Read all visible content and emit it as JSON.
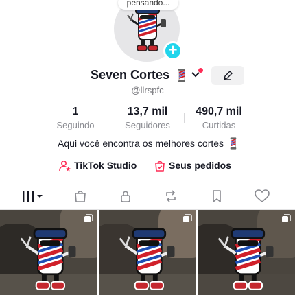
{
  "profile": {
    "status_bubble": "pensando...",
    "display_name": "Seven Cortes",
    "username": "@llrspfc",
    "bio": "Aqui você encontra os melhores cortes"
  },
  "stats": [
    {
      "value": "1",
      "label": "Seguindo"
    },
    {
      "value": "13,7 mil",
      "label": "Seguidores"
    },
    {
      "value": "490,7 mil",
      "label": "Curtidas"
    }
  ],
  "links": {
    "studio": "TikTok Studio",
    "orders": "Seus pedidos"
  },
  "tabs": [
    {
      "icon": "grid-icon",
      "active": true
    },
    {
      "icon": "shopping-bag-icon",
      "active": false
    },
    {
      "icon": "lock-icon",
      "active": false
    },
    {
      "icon": "repost-icon",
      "active": false
    },
    {
      "icon": "bookmark-icon",
      "active": false
    },
    {
      "icon": "heart-icon",
      "active": false
    }
  ],
  "videos": [
    {
      "type": "photo-carousel"
    },
    {
      "type": "photo-carousel"
    },
    {
      "type": "photo-carousel"
    }
  ],
  "colors": {
    "accent_cyan": "#20d5ec",
    "accent_red": "#fe2c55",
    "text_primary": "#161823",
    "text_secondary": "#8a8b91"
  }
}
